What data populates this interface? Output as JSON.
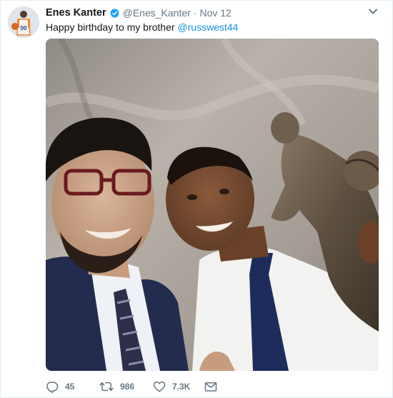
{
  "tweet": {
    "display_name": "Enes Kanter",
    "handle": "@Enes_Kanter",
    "separator": "·",
    "timestamp": "Nov 12",
    "text_prefix": "Happy birthday to my brother ",
    "mention": "@russwest44",
    "avatar_jersey_number": "00"
  },
  "actions": {
    "reply_count": "45",
    "retweet_count": "986",
    "like_count": "7.3K"
  },
  "icons": {
    "verified": "verified-badge-icon",
    "caret": "chevron-down-icon",
    "reply": "reply-icon",
    "retweet": "retweet-icon",
    "like": "heart-icon",
    "dm": "envelope-icon"
  },
  "colors": {
    "link": "#1b95e0",
    "secondary_text": "#657786",
    "verified": "#1da1f2",
    "primary_text": "#14171a"
  }
}
